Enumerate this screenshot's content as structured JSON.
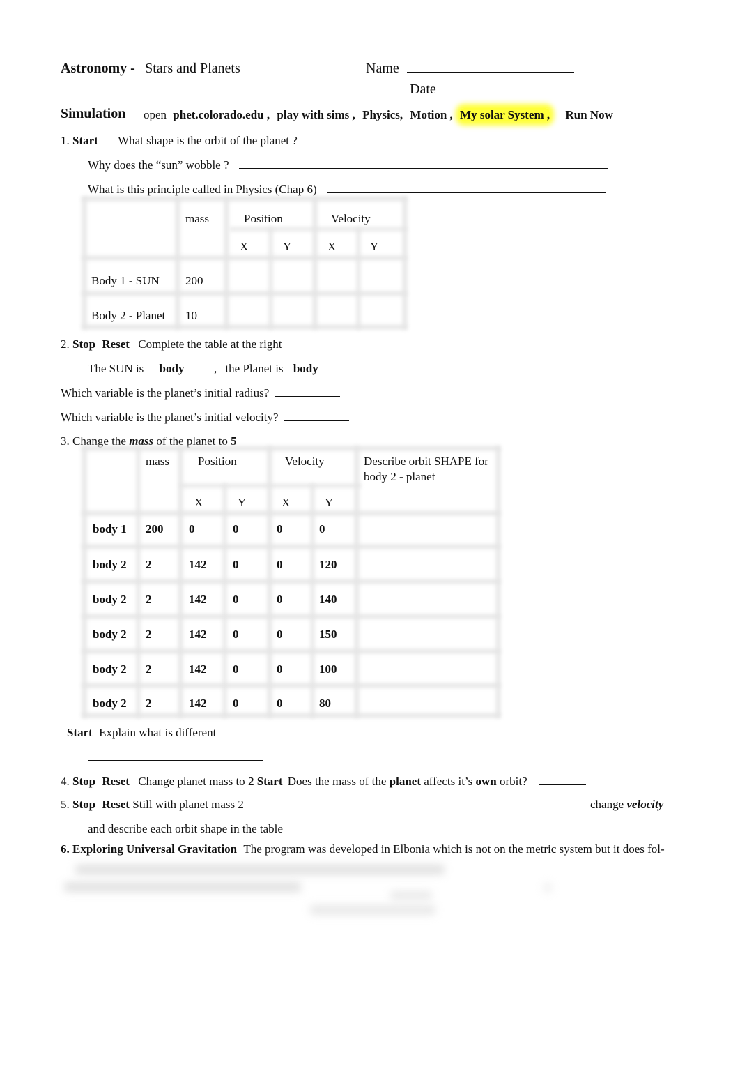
{
  "header": {
    "course": "Astronomy -",
    "subtitle": "Stars and Planets",
    "name_label": "Name",
    "date_label": "Date"
  },
  "simulation": {
    "heading": "Simulation",
    "open": "open",
    "site": "phet.colorado.edu ,",
    "play": "play with sims ,",
    "physics": "Physics,",
    "motion": "Motion ,",
    "my_solar": "My solar System ,",
    "run_now": "Run Now",
    "highlight_color": "#ffff3a"
  },
  "q1": {
    "num": "1.",
    "start": "Start",
    "q_shape": "What shape is the orbit of the planet ?",
    "q_wobble": "Why does the “sun” wobble ?",
    "q_principle": "What is this principle called in Physics (Chap 6)"
  },
  "table1": {
    "headers": {
      "mass": "mass",
      "position": "Position",
      "velocity": "Velocity",
      "x1": "X",
      "y1": "Y",
      "x2": "X",
      "y2": "Y"
    },
    "rows": [
      {
        "label": "Body 1 - SUN",
        "mass": "200"
      },
      {
        "label": "Body 2 - Planet",
        "mass": "10"
      }
    ]
  },
  "q2": {
    "num": "2.",
    "stop": "Stop",
    "reset": "Reset",
    "text": "Complete the table at the right",
    "sun_is": "The SUN is",
    "body1": "body",
    "sep": ",",
    "planet_is": "the Planet is",
    "body2": "body",
    "q_radius": "Which variable is the planet’s initial radius?",
    "q_velocity": "Which variable is the planet’s initial velocity?"
  },
  "q3": {
    "prefix": "3. Change the",
    "mass_word": "mass",
    "mid": "of the planet to",
    "value": "5"
  },
  "table2": {
    "headers": {
      "mass": "mass",
      "position": "Position",
      "velocity": "Velocity",
      "describe_line1": "Describe orbit SHAPE for",
      "describe_line2": "body 2 - planet",
      "x1": "X",
      "y1": "Y",
      "x2": "X",
      "y2": "Y"
    },
    "rows": [
      {
        "body": "body 1",
        "mass": "200",
        "px": "0",
        "py": "0",
        "vx": "0",
        "vy": "0"
      },
      {
        "body": "body 2",
        "mass": "2",
        "px": "142",
        "py": "0",
        "vx": "0",
        "vy": "120"
      },
      {
        "body": "body 2",
        "mass": "2",
        "px": "142",
        "py": "0",
        "vx": "0",
        "vy": "140"
      },
      {
        "body": "body 2",
        "mass": "2",
        "px": "142",
        "py": "0",
        "vx": "0",
        "vy": "150"
      },
      {
        "body": "body 2",
        "mass": "2",
        "px": "142",
        "py": "0",
        "vx": "0",
        "vy": "100"
      },
      {
        "body": "body 2",
        "mass": "2",
        "px": "142",
        "py": "0",
        "vx": "0",
        "vy": "80"
      }
    ]
  },
  "explain": {
    "start": "Start",
    "text": "Explain what is different"
  },
  "q4": {
    "num": "4.",
    "stop": "Stop",
    "reset": "Reset",
    "text1": "Change planet mass  to",
    "value": "2 Start",
    "text2": "Does the mass of the",
    "planet": "planet",
    "text3": "affects it’s",
    "own": "own",
    "text4": "orbit?"
  },
  "q5": {
    "num": "5.",
    "stop": "Stop",
    "reset": "Reset",
    "text": "Still with planet mass 2",
    "change": "change",
    "velocity": "velocity",
    "line2": "and describe each orbit shape in the table"
  },
  "q6": {
    "title": "6. Exploring Universal Gravitation",
    "text": "The program was developed in Elbonia which is not on the metric system but it does fol-"
  }
}
